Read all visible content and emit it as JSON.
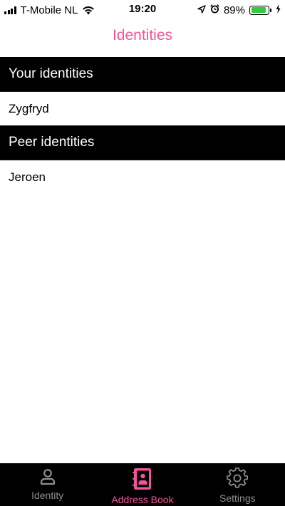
{
  "status_bar": {
    "carrier": "T-Mobile NL",
    "time": "19:20",
    "battery_percent": "89%",
    "battery_level": 0.89,
    "icons": [
      "signal-icon",
      "wifi-icon",
      "location-icon",
      "alarm-icon",
      "battery-icon",
      "charging-icon"
    ]
  },
  "nav": {
    "title": "Identities"
  },
  "sections": [
    {
      "header": "Your identities",
      "rows": [
        "Zygfryd"
      ]
    },
    {
      "header": "Peer identities",
      "rows": [
        "Jeroen"
      ]
    }
  ],
  "tab_bar": {
    "tabs": [
      {
        "label": "Identity",
        "icon": "person-icon",
        "active": false
      },
      {
        "label": "Address Book",
        "icon": "address-book-icon",
        "active": true
      },
      {
        "label": "Settings",
        "icon": "gear-icon",
        "active": false
      }
    ]
  },
  "colors": {
    "accent": "#f0559b",
    "header_bg": "#000000",
    "tab_inactive": "#8e8e8e",
    "battery": "#2ecc40"
  }
}
